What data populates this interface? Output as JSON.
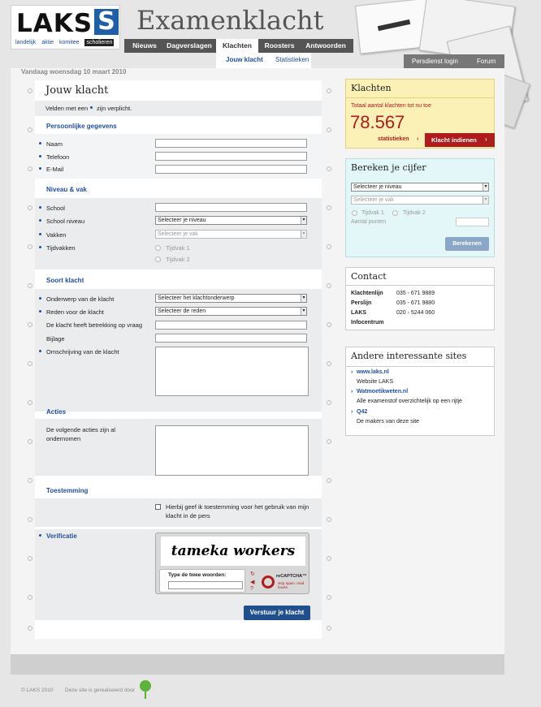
{
  "logo": {
    "letters": "LAKS",
    "s_letter": "S",
    "tags": [
      "landelijk",
      "aktie",
      "komitee"
    ],
    "school_tag": "scholieren"
  },
  "site_title": "Examenklacht",
  "nav": {
    "items": [
      "Nieuws",
      "Dagverslagen",
      "Klachten",
      "Roosters",
      "Antwoorden"
    ],
    "active": "Klachten"
  },
  "subnav": {
    "items": [
      "Jouw klacht",
      "Statistieken"
    ],
    "active": "Jouw klacht"
  },
  "right_nav": [
    "Persdienst login",
    "Forum"
  ],
  "date": "Vandaag woensdag 10 maart 2010",
  "form": {
    "title": "Jouw klacht",
    "required_pre": "Velden met een",
    "required_post": "zijn verplicht.",
    "sections": {
      "personal": "Persoonlijke gegevens",
      "level": "Niveau & vak",
      "type": "Soort klacht",
      "actions": "Acties",
      "consent": "Toestemming",
      "verification": "Verificatie"
    },
    "labels": {
      "name": "Naam",
      "phone": "Telefoon",
      "email": "E-Mail",
      "school": "School",
      "school_level": "School niveau",
      "subjects": "Vakken",
      "periods": "Tijdvakken",
      "subject_of_complaint": "Onderwerp van de klacht",
      "reason": "Reden voor de klacht",
      "question": "De klacht heeft betrekking op vraag",
      "attachment": "Bijlage",
      "description": "Omschrijving van de klacht",
      "actions_q1": "De volgende acties zijn al",
      "actions_q2": "ondernomen",
      "consent1": "Hierbij geef ik toestemming voor het gebruik van mijn",
      "consent2": "klacht in de pers"
    },
    "selects": {
      "level": "Selecteer je niveau",
      "subject": "Selecteer je vak",
      "complaint_subject": "Selecteer het klachtonderwerp",
      "reason": "Selecteer de reden"
    },
    "periods": [
      "Tijdvak 1",
      "Tijdvak 2"
    ],
    "captcha": {
      "words": "tameka workers",
      "prompt": "Type de twee woorden:",
      "brand": "reCAPTCHA™",
      "tagline": "stop spam. read books."
    },
    "submit": "Verstuur je klacht"
  },
  "klachten_box": {
    "title": "Klachten",
    "total_label": "Totaal aantal klachten tot nu toe",
    "total": "78.567",
    "stats_link": "statistieken",
    "submit_btn": "Klacht indienen",
    "accent": "#b01c1c"
  },
  "grade_box": {
    "title": "Bereken je cijfer",
    "level_select": "Selecteer je niveau",
    "subject_select": "Selecteer je vak",
    "periods": [
      "Tijdvak 1",
      "Tijdvak 2"
    ],
    "points_label": "Aantal punten",
    "button": "Berekenen"
  },
  "contact_box": {
    "title": "Contact",
    "rows": [
      {
        "label": "Klachtenlijn",
        "value": "035 - 671 9889"
      },
      {
        "label": "Perslijn",
        "value": "035 - 671 9880"
      },
      {
        "label": "LAKS",
        "value": "020 - 5244 060"
      },
      {
        "label": "Infocentrum",
        "value": ""
      }
    ]
  },
  "sites_box": {
    "title": "Andere interessante sites",
    "links": [
      {
        "name": "www.laks.nl",
        "desc": "Website LAKS"
      },
      {
        "name": "Watmoetikweten.nl",
        "desc": "Alle examenstof overzichtelijk op een rijtje"
      },
      {
        "name": "Q42",
        "desc": "De makers van deze site"
      }
    ]
  },
  "footer": {
    "copyright": "© LAKS 2010",
    "made_by": "Deze site is gerealiseerd door"
  }
}
